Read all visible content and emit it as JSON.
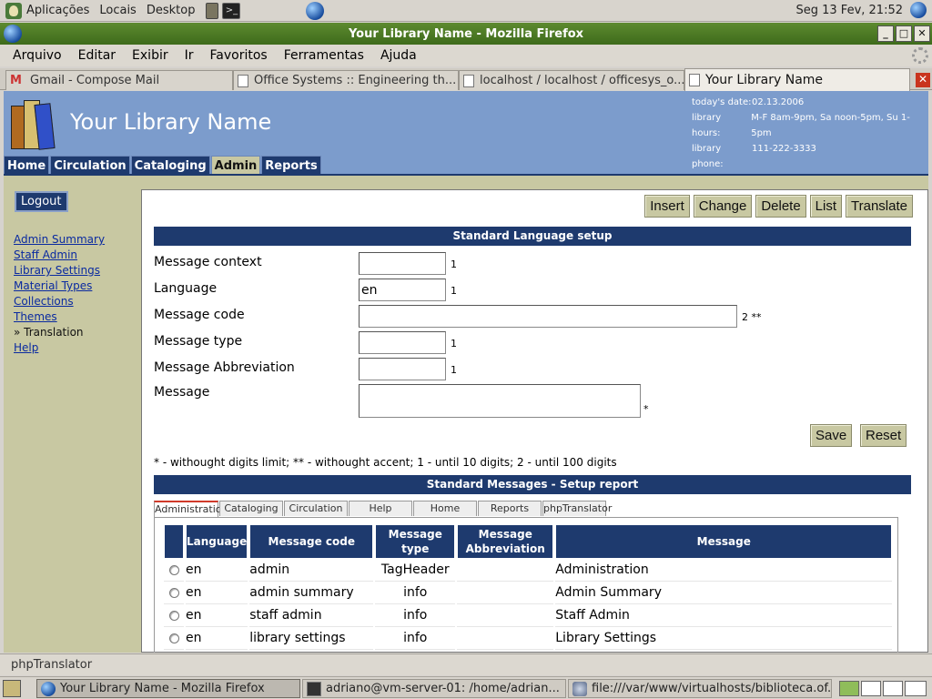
{
  "panel": {
    "menus": [
      "Aplicações",
      "Locais",
      "Desktop"
    ],
    "clock": "Seg 13 Fev, 21:52"
  },
  "window": {
    "title": "Your Library Name - Mozilla Firefox"
  },
  "menubar": [
    "Arquivo",
    "Editar",
    "Exibir",
    "Ir",
    "Favoritos",
    "Ferramentas",
    "Ajuda"
  ],
  "tabs": [
    {
      "label": "Gmail - Compose Mail"
    },
    {
      "label": "Office Systems :: Engineering th..."
    },
    {
      "label": "localhost / localhost / officesys_o..."
    },
    {
      "label": "Your Library Name"
    }
  ],
  "library": {
    "name": "Your Library Name",
    "info": [
      {
        "k": "today's date:",
        "v": "02.13.2006"
      },
      {
        "k": "library hours:",
        "v": "M-F 8am-9pm, Sa noon-5pm, Su 1-5pm"
      },
      {
        "k": "library phone:",
        "v": "111-222-3333"
      }
    ],
    "nav": [
      "Home",
      "Circulation",
      "Cataloging",
      "Admin",
      "Reports"
    ]
  },
  "sidebar": {
    "logout": "Logout",
    "links": [
      "Admin Summary",
      "Staff Admin",
      "Library Settings",
      "Material Types",
      "Collections",
      "Themes"
    ],
    "current": "» Translation",
    "help": "Help"
  },
  "actions": [
    "Insert",
    "Change",
    "Delete",
    "List",
    "Translate"
  ],
  "form": {
    "title": "Standard Language setup",
    "fields": [
      {
        "label": "Message context",
        "value": "",
        "note": "1"
      },
      {
        "label": "Language",
        "value": "en",
        "note": "1"
      },
      {
        "label": "Message code",
        "value": "",
        "note": "2 **"
      },
      {
        "label": "Message type",
        "value": "",
        "note": "1"
      },
      {
        "label": "Message Abbreviation",
        "value": "",
        "note": "1"
      },
      {
        "label": "Message",
        "value": "",
        "note": "*"
      }
    ],
    "save": "Save",
    "reset": "Reset",
    "legend": "* - withought digits limit; ** - withought accent; 1 - until 10 digits; 2 - until 100 digits"
  },
  "report": {
    "title": "Standard Messages - Setup report",
    "tabs": [
      "Administration",
      "Cataloging",
      "Circulation",
      "Help",
      "Home",
      "Reports",
      "phpTranslator"
    ],
    "headers": [
      "Language",
      "Message code",
      "Message type",
      "Message Abbreviation",
      "Message"
    ],
    "rows": [
      [
        "en",
        "admin",
        "TagHeader",
        "",
        "Administration"
      ],
      [
        "en",
        "admin summary",
        "info",
        "",
        "Admin Summary"
      ],
      [
        "en",
        "staff admin",
        "info",
        "",
        "Staff Admin"
      ],
      [
        "en",
        "library settings",
        "info",
        "",
        "Library Settings"
      ]
    ]
  },
  "status": "phpTranslator",
  "taskbar": [
    {
      "label": "Your Library Name - Mozilla Firefox"
    },
    {
      "label": "adriano@vm-server-01: /home/adrian..."
    },
    {
      "label": "file:///var/www/virtualhosts/biblioteca.of..."
    }
  ],
  "colors": {
    "nav": "#1e3a6e",
    "header": "#7c9ccc",
    "sidebar": "#c8c8a2",
    "titlebar": "#4a7a24"
  }
}
